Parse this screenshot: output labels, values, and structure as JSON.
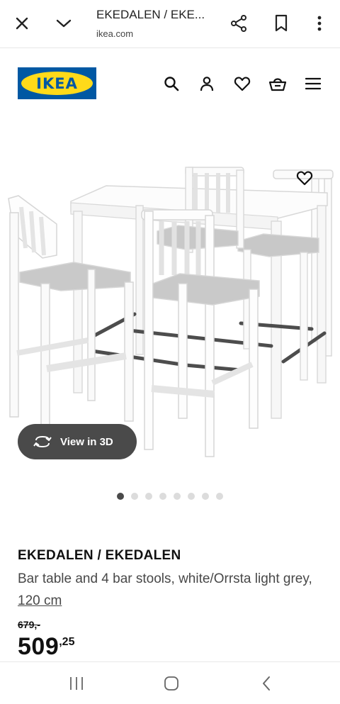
{
  "browser": {
    "title": "EKEDALEN / EKE...",
    "url": "ikea.com",
    "icons": [
      "close-icon",
      "chevron-down-icon",
      "share-icon",
      "bookmark-icon",
      "more-vert-icon"
    ]
  },
  "header": {
    "logo_text": "IKEA",
    "icons": [
      "search-icon",
      "account-icon",
      "favourites-icon",
      "basket-icon",
      "menu-icon"
    ]
  },
  "gallery": {
    "view_3d_label": "View in 3D",
    "dots_total": 8,
    "active_dot": 1
  },
  "product": {
    "name": "EKEDALEN / EKEDALEN",
    "description": "Bar table and 4 bar stools, white/Orrsta light grey, ",
    "size": "120 cm",
    "old_price": "679,-",
    "price_integer": "509",
    "price_decimal": ",25"
  },
  "colors": {
    "ikea_blue": "#0058a3",
    "ikea_yellow": "#ffda1a",
    "pill_bg": "#4a4a4a"
  },
  "system_nav": {
    "icons": [
      "recent-apps-icon",
      "home-icon",
      "back-icon"
    ]
  }
}
